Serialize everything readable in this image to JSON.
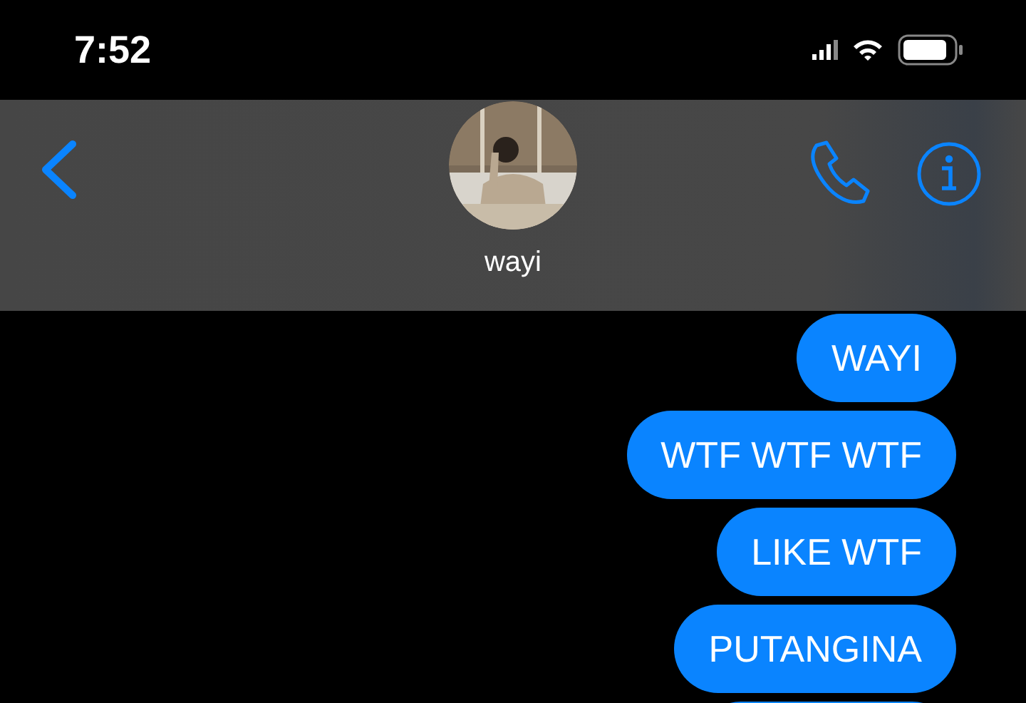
{
  "status_bar": {
    "time": "7:52"
  },
  "header": {
    "contact_name": "wayi"
  },
  "messages": [
    {
      "kind": "text",
      "text": "WAYI"
    },
    {
      "kind": "text",
      "text": "WTF WTF WTF"
    },
    {
      "kind": "text",
      "text": "LIKE WTF"
    },
    {
      "kind": "text",
      "text": "PUTANGINA"
    },
    {
      "kind": "clipped"
    }
  ]
}
